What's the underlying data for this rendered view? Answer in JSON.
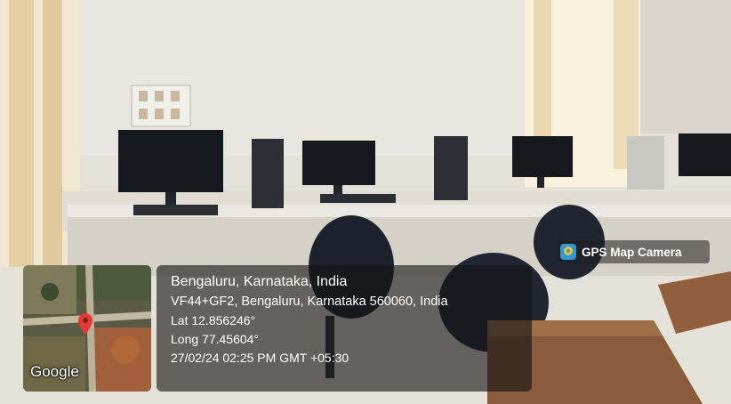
{
  "photo": {
    "description_colors": {
      "wall": "#e6e2d8",
      "window": "#f4ecd0",
      "desk": "#e2ded4",
      "chair": "#1f2630",
      "table": "#8a5a3a"
    }
  },
  "badge": {
    "label": "GPS Map Camera",
    "icon": "gps-map-camera-icon"
  },
  "location": {
    "title": "Bengaluru, Karnataka, India",
    "address": "VF44+GF2, Bengaluru, Karnataka 560060, India",
    "lat": "Lat 12.856246°",
    "long": "Long 77.45604°",
    "timestamp": "27/02/24 02:25 PM GMT +05:30"
  },
  "map": {
    "provider": "Google",
    "pin_icon": "map-pin-icon"
  }
}
